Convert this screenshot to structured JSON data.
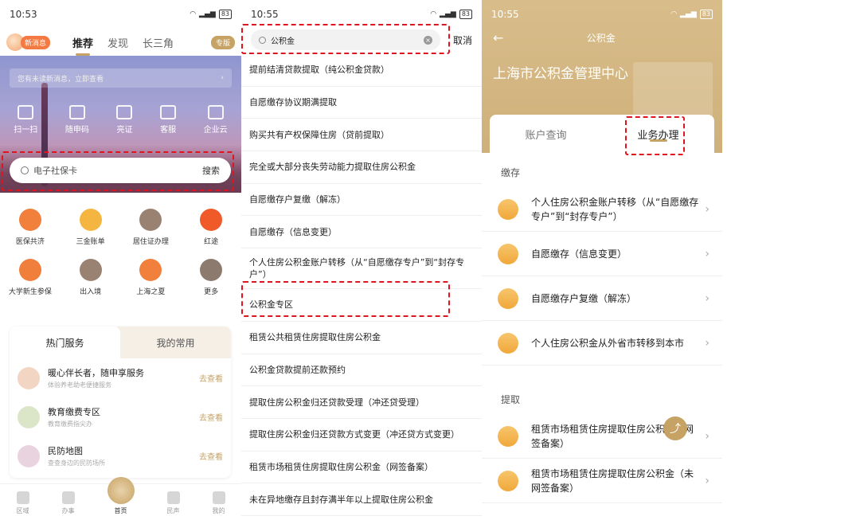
{
  "panel1": {
    "time": "10:53",
    "battery": "83",
    "new_msg": "新消息",
    "tabs": [
      "推荐",
      "发现",
      "长三角"
    ],
    "elder_mode": "专版",
    "notice": "您有未读新消息，立即查看",
    "quick_actions": [
      "扫一扫",
      "随申码",
      "亮证",
      "客服",
      "企业云"
    ],
    "search_placeholder": "电子社保卡",
    "search_button": "搜索",
    "grid": [
      {
        "label": "医保共济",
        "color": "#f0803c"
      },
      {
        "label": "三金账单",
        "color": "#f4b640"
      },
      {
        "label": "居住证办理",
        "color": "#9a8272"
      },
      {
        "label": "红途",
        "color": "#f05a28"
      },
      {
        "label": "大学新生参保",
        "color": "#f07f3c"
      },
      {
        "label": "出入境",
        "color": "#9a8272"
      },
      {
        "label": "上海之夏",
        "color": "#f0803c"
      },
      {
        "label": "更多",
        "color": "#8c7a6e"
      }
    ],
    "card_tabs": [
      "热门服务",
      "我的常用"
    ],
    "services": [
      {
        "title": "暖心伴长者，随申享服务",
        "sub": "体验养老助老便捷服务",
        "go": "去查看"
      },
      {
        "title": "教育缴费专区",
        "sub": "教育缴费指尖办",
        "go": "去查看"
      },
      {
        "title": "民防地图",
        "sub": "查查身边的民防场所",
        "go": "去查看"
      }
    ],
    "bottom_nav": [
      "区域",
      "办事",
      "首页",
      "民声",
      "我的"
    ]
  },
  "panel2": {
    "time": "10:55",
    "battery": "83",
    "search_value": "公积金",
    "cancel": "取消",
    "results": [
      "提前结清贷款提取（纯公积金贷款）",
      "自愿缴存协议期满提取",
      "购买共有产权保障住房（贷前提取）",
      "完全或大部分丧失劳动能力提取住房公积金",
      "自愿缴存户复缴（解冻）",
      "自愿缴存（信息变更）",
      "个人住房公积金账户转移（从“自愿缴存专户”到“封存专户”）",
      "公积金专区",
      "租赁公共租赁住房提取住房公积金",
      "公积金贷款提前还款预约",
      "提取住房公积金归还贷款受理（冲还贷受理）",
      "提取住房公积金归还贷款方式变更（冲还贷方式变更）",
      "租赁市场租赁住房提取住房公积金（网签备案）",
      "未在异地缴存且封存满半年以上提取住房公积金"
    ]
  },
  "panel3": {
    "time": "10:55",
    "battery": "83",
    "title": "公积金",
    "org": "上海市公积金管理中心",
    "tabs": [
      "账户查询",
      "业务办理"
    ],
    "section_deposit": "缴存",
    "deposit_items": [
      "个人住房公积金账户转移（从“自愿缴存专户”到“封存专户”）",
      "自愿缴存（信息变更）",
      "自愿缴存户复缴（解冻）",
      "个人住房公积金从外省市转移到本市"
    ],
    "section_withdraw": "提取",
    "withdraw_items": [
      "租赁市场租赁住房提取住房公积金（网签备案）",
      "租赁市场租赁住房提取住房公积金（未网签备案）"
    ]
  }
}
